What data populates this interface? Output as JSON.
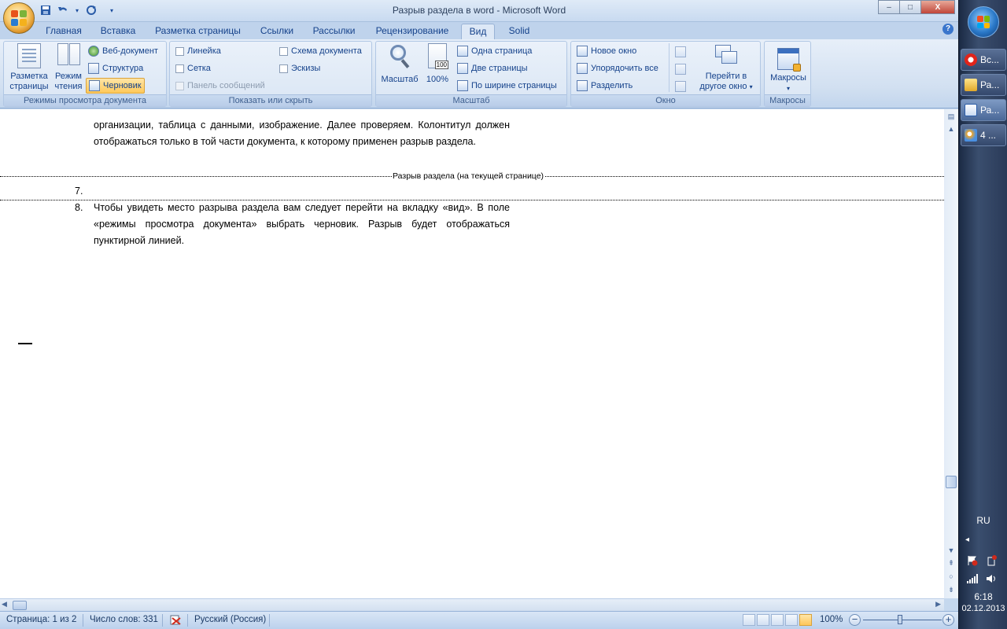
{
  "window": {
    "title": "Разрыв раздела в word - Microsoft Word",
    "controls": {
      "minimize": "–",
      "maximize": "□",
      "close": "X"
    }
  },
  "qat": {
    "save": "save-icon",
    "undo": "undo-icon",
    "redo": "redo-icon",
    "more": "▾"
  },
  "tabs": [
    {
      "label": "Главная"
    },
    {
      "label": "Вставка"
    },
    {
      "label": "Разметка страницы"
    },
    {
      "label": "Ссылки"
    },
    {
      "label": "Рассылки"
    },
    {
      "label": "Рецензирование"
    },
    {
      "label": "Вид",
      "active": true
    },
    {
      "label": "Solid"
    }
  ],
  "help": "?",
  "ribbon": {
    "views": {
      "label": "Режимы просмотра документа",
      "page_layout_l1": "Разметка",
      "page_layout_l2": "страницы",
      "reading_l1": "Режим",
      "reading_l2": "чтения",
      "web": "Веб-документ",
      "outline": "Структура",
      "draft": "Черновик"
    },
    "show": {
      "label": "Показать или скрыть",
      "ruler": "Линейка",
      "gridlines": "Сетка",
      "message_bar": "Панель сообщений",
      "doc_map": "Схема документа",
      "thumbnails": "Эскизы"
    },
    "zoom": {
      "label": "Масштаб",
      "zoom_btn": "Масштаб",
      "hundred": "100%",
      "hundred_badge": "100",
      "one_page": "Одна страница",
      "two_pages": "Две страницы",
      "page_width": "По ширине страницы"
    },
    "window": {
      "label": "Окно",
      "new_window": "Новое окно",
      "arrange_all": "Упорядочить все",
      "split": "Разделить",
      "switch_l1": "Перейти в",
      "switch_l2": "другое окно",
      "switch_arrow": "▾"
    },
    "macros": {
      "label": "Макросы",
      "macros_btn": "Макросы",
      "macros_arrow": "▾"
    }
  },
  "document": {
    "para_top": "организации, таблица с данными, изображение. Далее  проверяем. Колонтитул должен отображаться только в той части документа, к которому применен разрыв раздела.",
    "section_break": "Разрыв раздела (на текущей странице)",
    "item7_num": "7.",
    "item8_num": "8.",
    "item8_text": "Чтобы увидеть место разрыва раздела вам следует перейти на вкладку «вид». В поле «режимы просмотра документа» выбрать черновик. Разрыв будет отображаться пунктирной линией."
  },
  "scrollbars": {
    "up": "▲",
    "down": "▼",
    "left": "◀",
    "right": "▶",
    "ruler_toggle": "▤",
    "prev_page": "⇞",
    "select_browse": "○",
    "next_page": "⇟"
  },
  "status": {
    "page": "Страница: 1 из 2",
    "words": "Число слов: 331",
    "language": "Русский (Россия)",
    "zoom": "100%",
    "zoom_minus": "−",
    "zoom_plus": "+"
  },
  "taskbar": {
    "buttons": [
      {
        "label": "Вс..."
      },
      {
        "label": "Ра..."
      },
      {
        "label": "Ра...",
        "active": true
      },
      {
        "label": "4 ..."
      }
    ],
    "lang": "RU",
    "show_hidden": "◂",
    "time": "6:18",
    "date": "02.12.2013"
  },
  "colors": {
    "accent": "#15428b",
    "ribbon": "#dae6f4",
    "selected": "#ffc95a",
    "taskbar": "#2a3a58"
  }
}
